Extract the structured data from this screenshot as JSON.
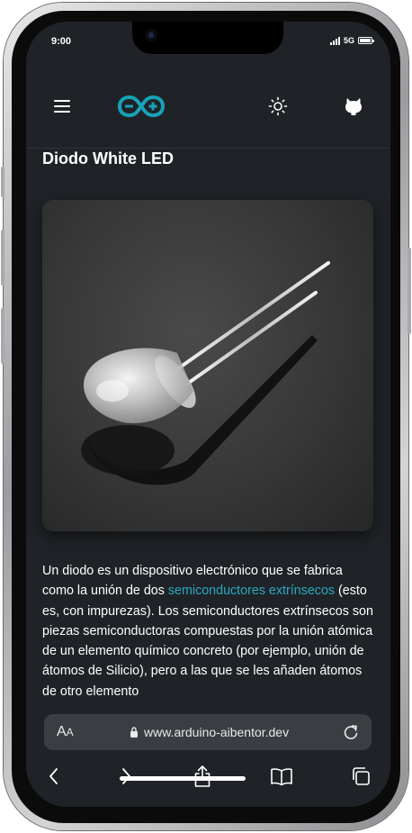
{
  "status_bar": {
    "time": "9:00",
    "network": "5G"
  },
  "header": {
    "menu_icon": "hamburger-menu-icon",
    "logo_icon": "arduino-logo-icon",
    "theme_icon": "sun-icon",
    "repo_icon": "github-icon",
    "logo_color": "#17a2b8"
  },
  "article": {
    "title": "Diodo White LED",
    "image_alt": "White LED diode",
    "para_before_link": "Un diodo es un dispositivo electrónico que se fabrica como la unión de dos ",
    "link_text": "semiconductores extrínsecos",
    "para_after_link": " (esto es, con impurezas). Los semiconductores extrínsecos son piezas semiconductoras compuestas por la unión atómica de un elemento químico concreto (por ejemplo, unión de átomos de Silicio), pero a las que se les añaden átomos de otro elemento",
    "link_color": "#2aa8c2"
  },
  "browser": {
    "text_size_label": "A",
    "text_size_label_small": "A",
    "url": "www.arduino-aibentor.dev",
    "lock_icon": "lock-icon",
    "reload_icon": "reload-icon",
    "nav": [
      "back-icon",
      "forward-icon",
      "share-icon",
      "bookmarks-icon",
      "tabs-icon"
    ]
  },
  "colors": {
    "background": "#1f2327",
    "text": "#ffffff"
  }
}
